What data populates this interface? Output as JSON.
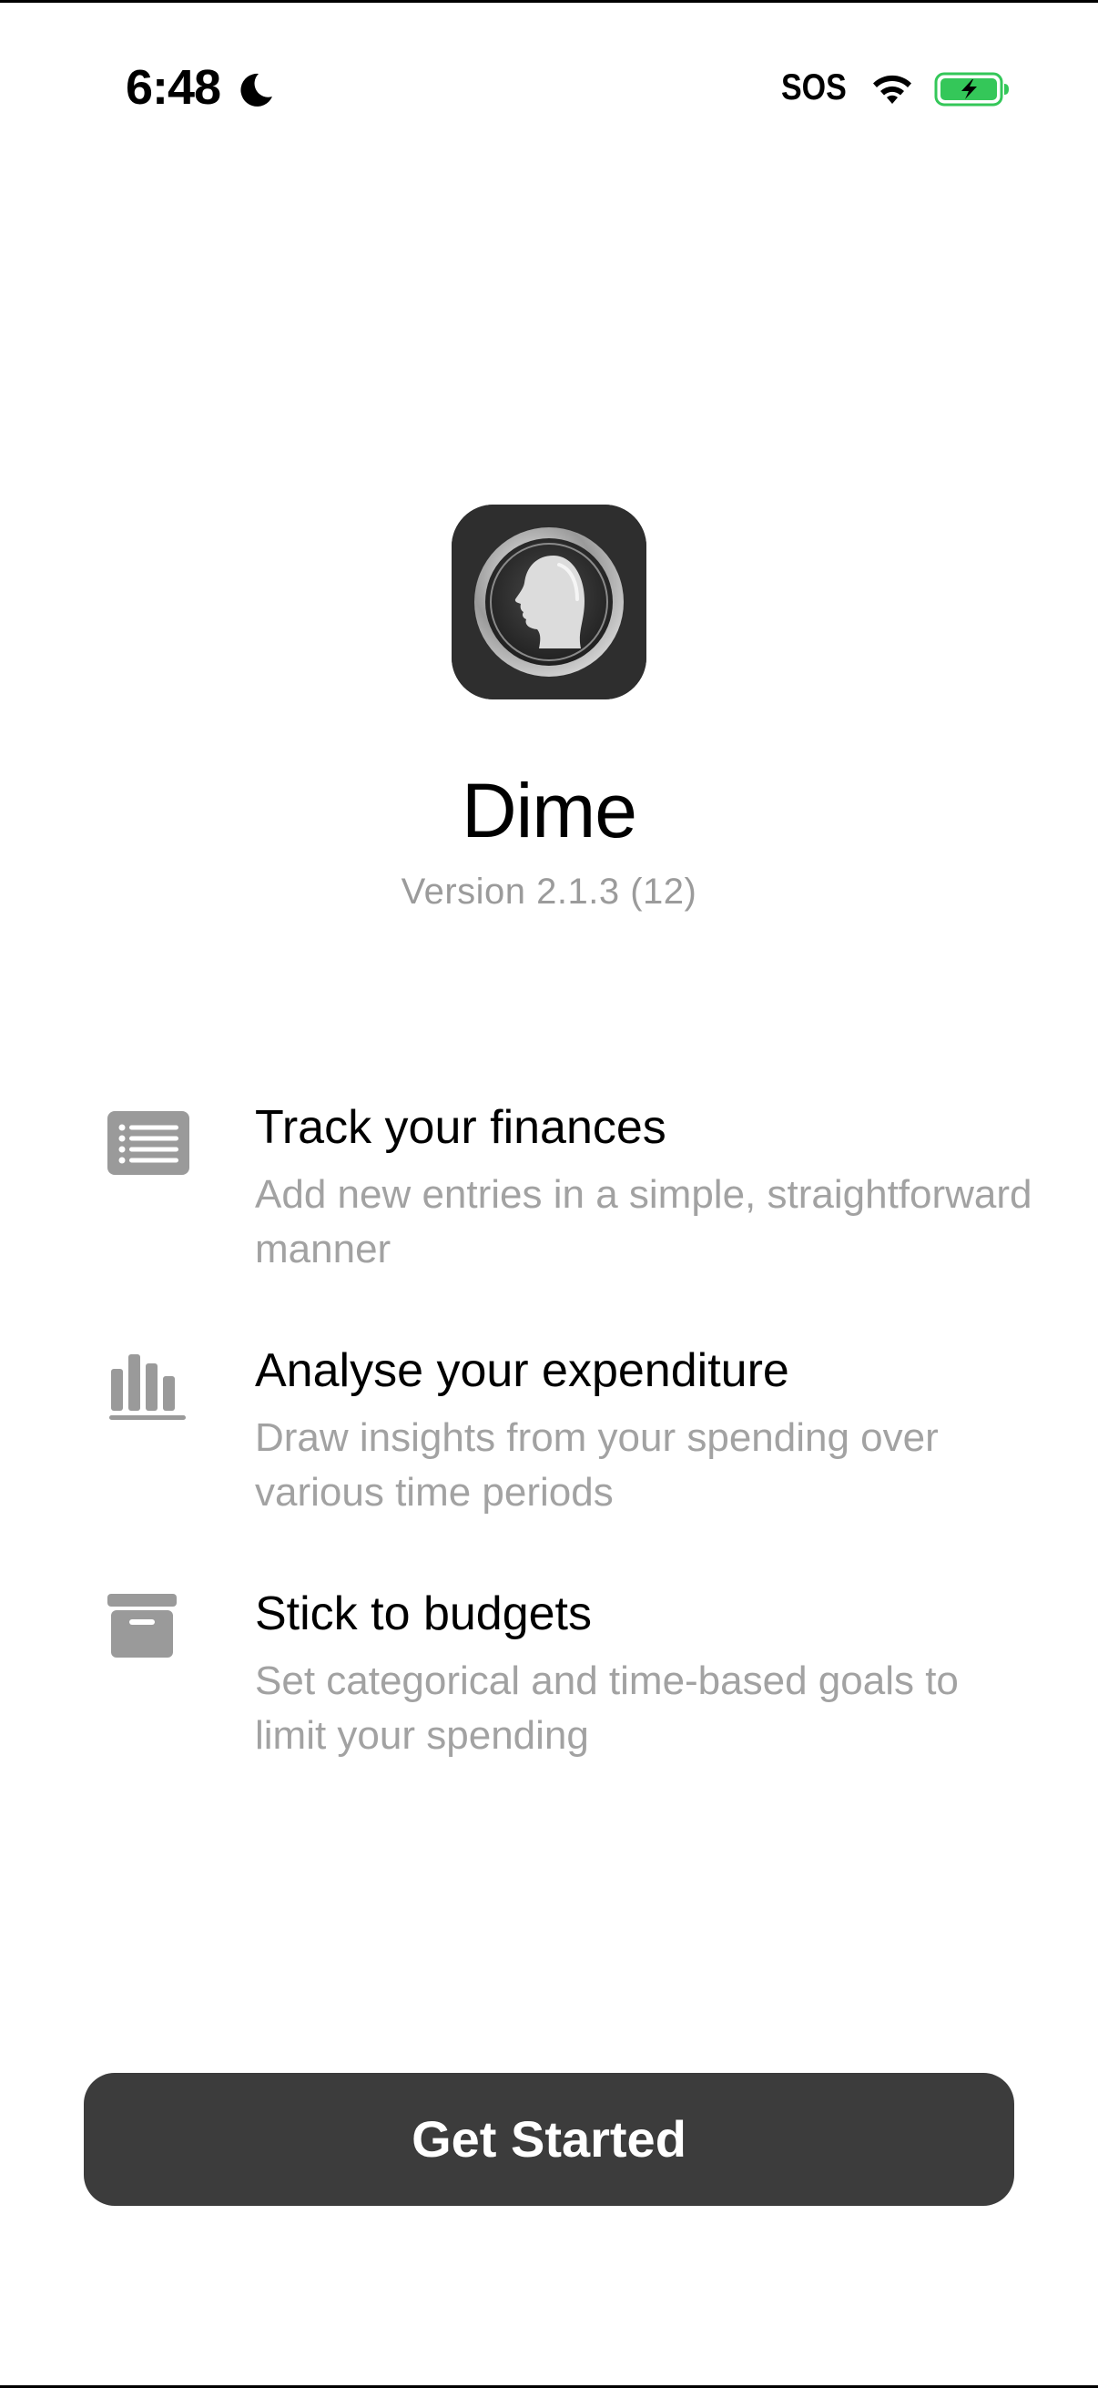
{
  "status_bar": {
    "time": "6:48",
    "carrier_status": "SOS",
    "icons": [
      "moon-icon",
      "wifi-icon",
      "battery-charging-icon"
    ],
    "battery_color": "#34c759"
  },
  "app": {
    "name": "Dime",
    "version": "Version 2.1.3 (12)",
    "icon": "coin-profile-icon"
  },
  "features": [
    {
      "icon": "list-icon",
      "title": "Track your finances",
      "description": "Add new entries in a simple, straightforward manner"
    },
    {
      "icon": "bar-chart-icon",
      "title": "Analyse your expenditure",
      "description": "Draw insights from your spending over various time periods"
    },
    {
      "icon": "archive-box-icon",
      "title": "Stick to budgets",
      "description": "Set categorical and time-based goals to limit your spending"
    }
  ],
  "cta": {
    "label": "Get Started",
    "background": "#3c3c3c"
  }
}
